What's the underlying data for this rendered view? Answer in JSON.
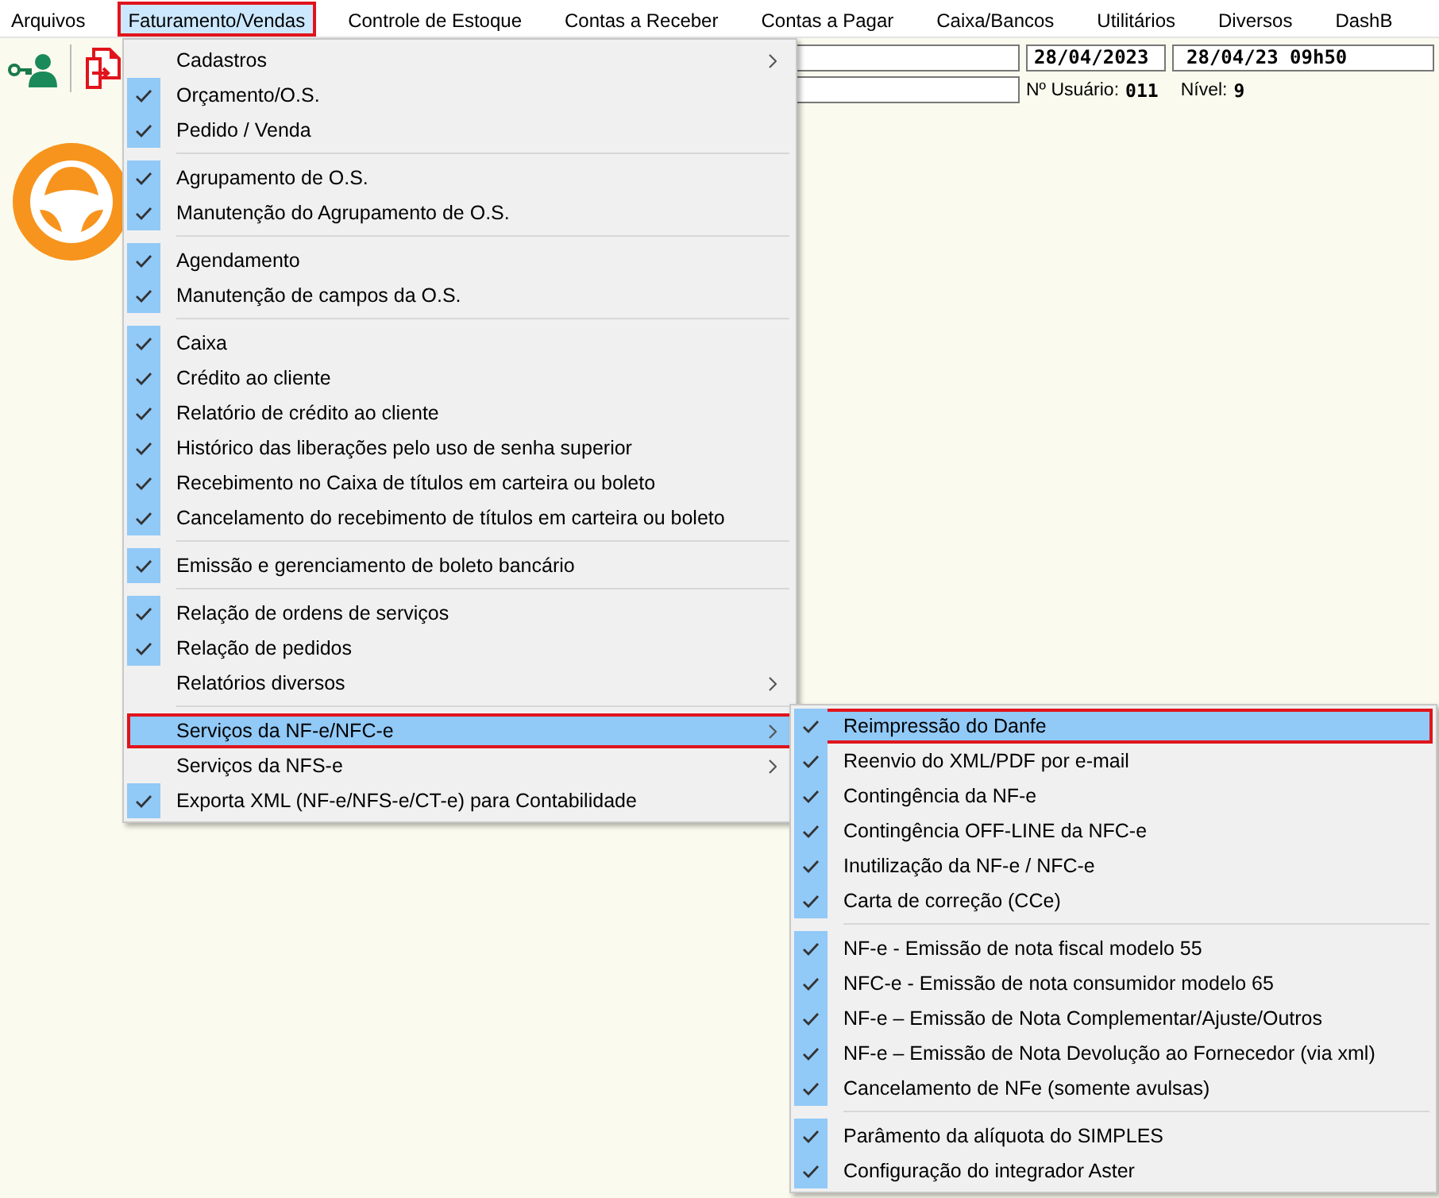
{
  "menubar": [
    {
      "label": "Arquivos",
      "selected": false
    },
    {
      "label": "Faturamento/Vendas",
      "selected": true
    },
    {
      "label": "Controle de Estoque",
      "selected": false
    },
    {
      "label": "Contas a Receber",
      "selected": false
    },
    {
      "label": "Contas a Pagar",
      "selected": false
    },
    {
      "label": "Caixa/Bancos",
      "selected": false
    },
    {
      "label": "Utilitários",
      "selected": false
    },
    {
      "label": "Diversos",
      "selected": false
    },
    {
      "label": "DashB",
      "selected": false
    }
  ],
  "status": {
    "date": "28/04/2023",
    "datetime": "28/04/23 09h50",
    "user_label": "Nº Usuário:",
    "user": "011",
    "level_label": "Nível:",
    "level_value": "9"
  },
  "menu": {
    "groups": [
      [
        {
          "label": "Cadastros",
          "checked": false,
          "has_submenu": true,
          "selected": false
        },
        {
          "label": "Orçamento/O.S.",
          "checked": true,
          "has_submenu": false,
          "selected": false
        },
        {
          "label": "Pedido / Venda",
          "checked": true,
          "has_submenu": false,
          "selected": false
        }
      ],
      [
        {
          "label": "Agrupamento de O.S.",
          "checked": true,
          "has_submenu": false,
          "selected": false
        },
        {
          "label": "Manutenção do Agrupamento de O.S.",
          "checked": true,
          "has_submenu": false,
          "selected": false
        }
      ],
      [
        {
          "label": "Agendamento",
          "checked": true,
          "has_submenu": false,
          "selected": false
        },
        {
          "label": "Manutenção de campos da O.S.",
          "checked": true,
          "has_submenu": false,
          "selected": false
        }
      ],
      [
        {
          "label": "Caixa",
          "checked": true,
          "has_submenu": false,
          "selected": false
        },
        {
          "label": "Crédito ao cliente",
          "checked": true,
          "has_submenu": false,
          "selected": false
        },
        {
          "label": "Relatório de crédito ao cliente",
          "checked": true,
          "has_submenu": false,
          "selected": false
        },
        {
          "label": "Histórico das liberações pelo uso de senha superior",
          "checked": true,
          "has_submenu": false,
          "selected": false
        },
        {
          "label": "Recebimento no Caixa de títulos em carteira ou boleto",
          "checked": true,
          "has_submenu": false,
          "selected": false
        },
        {
          "label": "Cancelamento do recebimento de títulos em carteira ou boleto",
          "checked": true,
          "has_submenu": false,
          "selected": false
        }
      ],
      [
        {
          "label": "Emissão e gerenciamento de boleto bancário",
          "checked": true,
          "has_submenu": false,
          "selected": false
        }
      ],
      [
        {
          "label": "Relação de ordens de serviços",
          "checked": true,
          "has_submenu": false,
          "selected": false
        },
        {
          "label": "Relação de pedidos",
          "checked": true,
          "has_submenu": false,
          "selected": false
        },
        {
          "label": "Relatórios diversos",
          "checked": false,
          "has_submenu": true,
          "selected": false
        }
      ],
      [
        {
          "label": "Serviços da NF-e/NFC-e",
          "checked": false,
          "has_submenu": true,
          "selected": true
        },
        {
          "label": "Serviços da NFS-e",
          "checked": false,
          "has_submenu": true,
          "selected": false
        },
        {
          "label": "Exporta XML (NF-e/NFS-e/CT-e) para Contabilidade",
          "checked": true,
          "has_submenu": false,
          "selected": false
        }
      ]
    ]
  },
  "submenu": {
    "groups": [
      [
        {
          "label": "Reimpressão do Danfe",
          "checked": true,
          "has_submenu": false,
          "selected": true
        },
        {
          "label": "Reenvio do XML/PDF por e-mail",
          "checked": true,
          "has_submenu": false,
          "selected": false
        },
        {
          "label": "Contingência da NF-e",
          "checked": true,
          "has_submenu": false,
          "selected": false
        },
        {
          "label": "Contingência OFF-LINE da NFC-e",
          "checked": true,
          "has_submenu": false,
          "selected": false
        },
        {
          "label": "Inutilização da NF-e / NFC-e",
          "checked": true,
          "has_submenu": false,
          "selected": false
        },
        {
          "label": "Carta de correção (CCe)",
          "checked": true,
          "has_submenu": false,
          "selected": false
        }
      ],
      [
        {
          "label": "NF-e - Emissão de nota fiscal modelo 55",
          "checked": true,
          "has_submenu": false,
          "selected": false
        },
        {
          "label": "NFC-e - Emissão de nota consumidor modelo 65",
          "checked": true,
          "has_submenu": false,
          "selected": false
        },
        {
          "label": "NF-e – Emissão de Nota Complementar/Ajuste/Outros",
          "checked": true,
          "has_submenu": false,
          "selected": false
        },
        {
          "label": "NF-e – Emissão de Nota Devolução ao Fornecedor (via xml)",
          "checked": true,
          "has_submenu": false,
          "selected": false
        },
        {
          "label": "Cancelamento de NFe (somente avulsas)",
          "checked": true,
          "has_submenu": false,
          "selected": false
        }
      ],
      [
        {
          "label": "Parâmento da alíquota do SIMPLES",
          "checked": true,
          "has_submenu": false,
          "selected": false
        },
        {
          "label": "Configuração do integrador Aster",
          "checked": true,
          "has_submenu": false,
          "selected": false
        }
      ]
    ]
  }
}
